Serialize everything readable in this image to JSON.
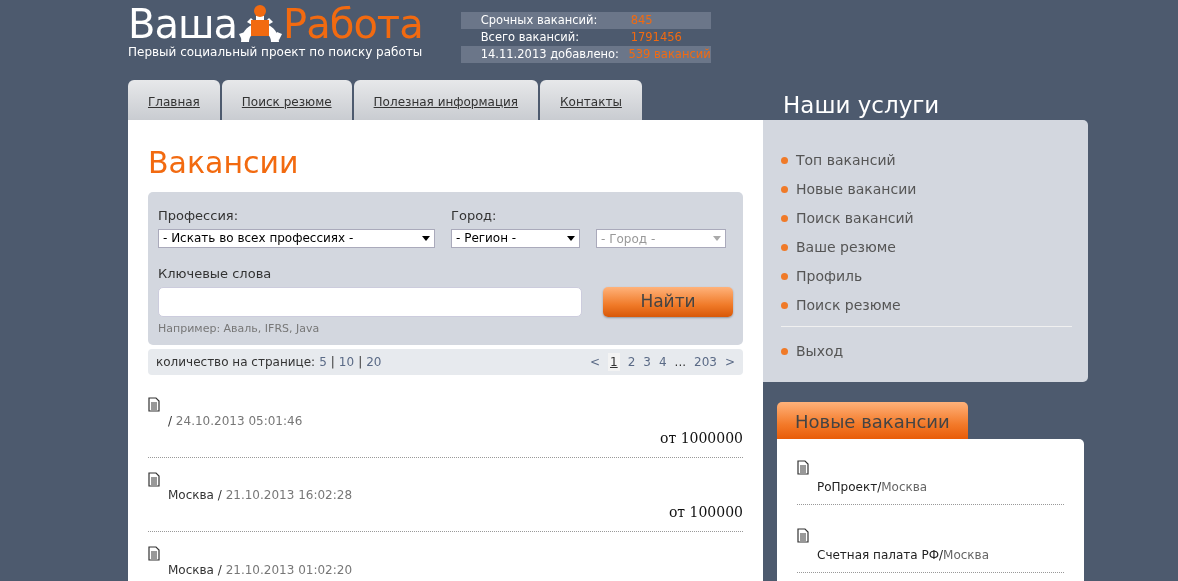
{
  "logo": {
    "word_left": "Ваша",
    "word_right": "Работа",
    "tagline": "Первый социальный проект по поиску работы"
  },
  "stats": [
    {
      "label": "Срочных вакансий:",
      "value": "845"
    },
    {
      "label": "Всего вакансий:",
      "value": "1791456"
    },
    {
      "label": "14.11.2013 добавлено:",
      "value": "539 вакансий"
    }
  ],
  "tabs": [
    {
      "label": "Главная"
    },
    {
      "label": "Поиск резюме"
    },
    {
      "label": "Полезная информация"
    },
    {
      "label": "Контакты"
    }
  ],
  "main": {
    "title": "Вакансии",
    "search": {
      "profession_label": "Профессия:",
      "profession": {
        "value": "- Искать во всех профессиях -",
        "disabled": false
      },
      "city_label": "Город:",
      "region": {
        "value": "- Регион -",
        "disabled": false
      },
      "city": {
        "value": "- Город -",
        "disabled": true
      },
      "keywords_label": "Ключевые слова",
      "search_button": "Найти",
      "hint": "Например: Аваль, IFRS, Java"
    },
    "per_page": {
      "label": "количество на странице:",
      "separator": "|",
      "options": [
        "5",
        "10",
        "20"
      ]
    },
    "pagination": {
      "prev": "<",
      "pages": [
        {
          "label": "1",
          "selected": true
        },
        {
          "label": "2",
          "selected": false
        },
        {
          "label": "3",
          "selected": false
        },
        {
          "label": "4",
          "selected": false
        }
      ],
      "ellipsis": "...",
      "last": "203",
      "next": ">"
    },
    "vacancies": [
      {
        "separator": "/",
        "date": "24.10.2013 05:01:46",
        "salary": "от 1000000"
      },
      {
        "city": "Москва",
        "separator": "/",
        "date": "21.10.2013 16:02:28",
        "salary": "от 100000"
      },
      {
        "city": "Москва",
        "separator": "/",
        "date": "21.10.2013 01:02:20"
      }
    ]
  },
  "services": {
    "title": "Наши услуги",
    "groups": [
      [
        "Топ вакансий",
        "Новые вакансии",
        "Поиск вакансий",
        "Ваше резюме",
        "Профиль",
        "Поиск резюме"
      ],
      [
        "Выход"
      ]
    ]
  },
  "new_vacancies": {
    "title": "Новые вакансии",
    "items": [
      {
        "company": "РоПроект",
        "separator": "/",
        "city": "Москва"
      },
      {
        "company": "Счетная палата РФ",
        "separator": "/",
        "city": "Москва"
      }
    ]
  }
}
